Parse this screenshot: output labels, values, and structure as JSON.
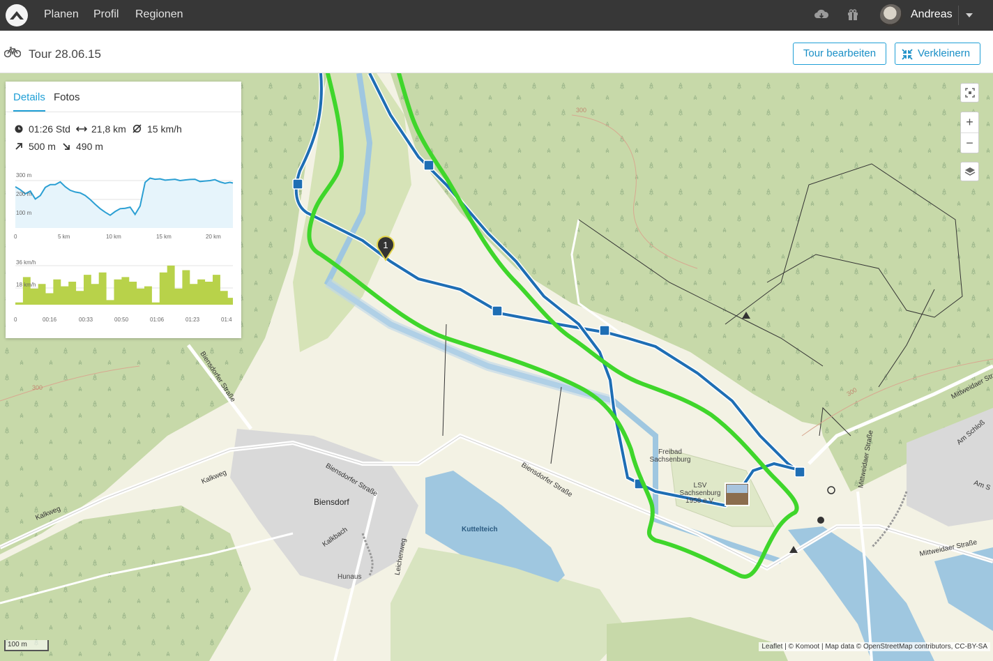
{
  "nav": {
    "items": [
      "Planen",
      "Profil",
      "Regionen"
    ],
    "user": "Andreas"
  },
  "tour": {
    "title": "Tour 28.06.15",
    "edit_button": "Tour bearbeiten",
    "shrink_button": "Verkleinern"
  },
  "panel": {
    "tabs": [
      "Details",
      "Fotos"
    ],
    "duration": "01:26 Std",
    "distance": "21,8 km",
    "avg_speed": "15 km/h",
    "ascent": "500 m",
    "descent": "490 m"
  },
  "chart_data": [
    {
      "type": "area",
      "xlabel": "",
      "ylabel": "",
      "y_tick_labels": [
        "300 m",
        "200 m",
        "100 m"
      ],
      "x_tick_labels": [
        "0",
        "5 km",
        "10 km",
        "15 km",
        "20 km"
      ],
      "x": [
        0,
        0.5,
        1,
        1.5,
        2,
        2.5,
        3,
        3.5,
        4,
        4.5,
        5,
        5.5,
        6,
        6.5,
        7,
        7.5,
        8,
        8.5,
        9,
        9.5,
        10,
        10.5,
        11,
        11.5,
        12,
        12.5,
        13,
        13.5,
        14,
        14.5,
        15,
        15.5,
        16,
        16.5,
        17,
        17.5,
        18,
        18.5,
        19,
        19.5,
        20,
        20.5,
        21,
        21.5,
        21.8
      ],
      "values": [
        238,
        224,
        206,
        218,
        182,
        198,
        235,
        248,
        248,
        260,
        238,
        222,
        214,
        210,
        198,
        180,
        158,
        138,
        122,
        108,
        125,
        138,
        140,
        145,
        112,
        150,
        258,
        277,
        272,
        274,
        268,
        270,
        272,
        266,
        269,
        271,
        272,
        262,
        264,
        266,
        270,
        260,
        254,
        258,
        255
      ],
      "ylim": [
        50,
        320
      ],
      "xlim": [
        0,
        21.8
      ]
    },
    {
      "type": "area",
      "xlabel": "",
      "ylabel": "",
      "y_tick_labels": [
        "36 km/h",
        "18 km/h"
      ],
      "x_tick_labels": [
        "0",
        "00:16",
        "00:33",
        "00:50",
        "01:06",
        "01:23",
        "01:4"
      ],
      "x": [
        0,
        3,
        6,
        9,
        12,
        15,
        18,
        21,
        24,
        27,
        30,
        33,
        36,
        39,
        42,
        45,
        48,
        51,
        54,
        57,
        60,
        63,
        66,
        69,
        72,
        75,
        78,
        81,
        84,
        86
      ],
      "values": [
        2,
        24,
        14,
        18,
        10,
        22,
        16,
        20,
        12,
        26,
        18,
        28,
        4,
        22,
        24,
        20,
        14,
        16,
        2,
        28,
        34,
        14,
        30,
        18,
        22,
        20,
        26,
        12,
        6,
        34
      ],
      "ylim": [
        0,
        40
      ],
      "xlim": [
        0,
        86
      ]
    }
  ],
  "map": {
    "places": [
      "Biensdorf",
      "Freibad Sachsenburg",
      "LSV Sachsenburg 1958 e.V.",
      "Kuttelteich",
      "Hunaus"
    ],
    "streets": [
      "Biensdorfer Straße",
      "Biensdorfer Straße",
      "Biensdorfer Straße",
      "Kalkweg",
      "Kalkweg",
      "Kalkbach",
      "Leichenweg",
      "Mittweidaer Straße",
      "Mittweidaer Straße",
      "Mittweidaer Straße",
      "Am Schloß",
      "Am S"
    ],
    "contours": [
      "300",
      "300",
      "300"
    ],
    "waypoint": "1",
    "scale": "100 m",
    "attribution_leaflet": "Leaflet",
    "attribution_rest": " | © Komoot | Map data © OpenStreetMap contributors, CC-BY-SA"
  }
}
